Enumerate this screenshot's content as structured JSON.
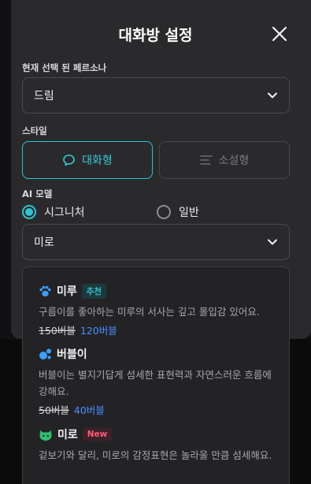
{
  "modal": {
    "title": "대화방 설정"
  },
  "persona": {
    "label": "현재 선택 된 페르소나",
    "value": "드림"
  },
  "style": {
    "label": "스타일",
    "options": [
      {
        "label": "대화형",
        "icon": "chat-bubble-icon",
        "selected": true
      },
      {
        "label": "소설형",
        "icon": "text-lines-icon",
        "selected": false
      }
    ]
  },
  "ai_model": {
    "label": "AI 모델",
    "tiers": [
      {
        "label": "시그니처",
        "selected": true
      },
      {
        "label": "일반",
        "selected": false
      }
    ],
    "selected_model": "미로",
    "models": [
      {
        "name": "미루",
        "badge": "추천",
        "description": "구름이를 좋아하는 미루의 서사는 깊고 몰입감 있어요.",
        "old_price": "150버블",
        "price": "120버블",
        "icon": "paw-icon"
      },
      {
        "name": "버블이",
        "badge": "",
        "description": "버블이는 별지기답게 섬세한 표현력과 자연스러운 흐름에 강해요.",
        "old_price": "50버블",
        "price": "40버블",
        "icon": "bubbles-icon"
      },
      {
        "name": "미로",
        "badge": "New",
        "description": "겉보기와 달리, 미로의 감정표현은 놀라울 만큼 섬세해요.",
        "old_price": "",
        "price": "",
        "icon": "green-cat-icon"
      }
    ]
  },
  "colors": {
    "accent": "#2fc4cf",
    "price": "#4b8dff",
    "new_badge": "#ff5a78",
    "background": "#2a2a2d"
  }
}
